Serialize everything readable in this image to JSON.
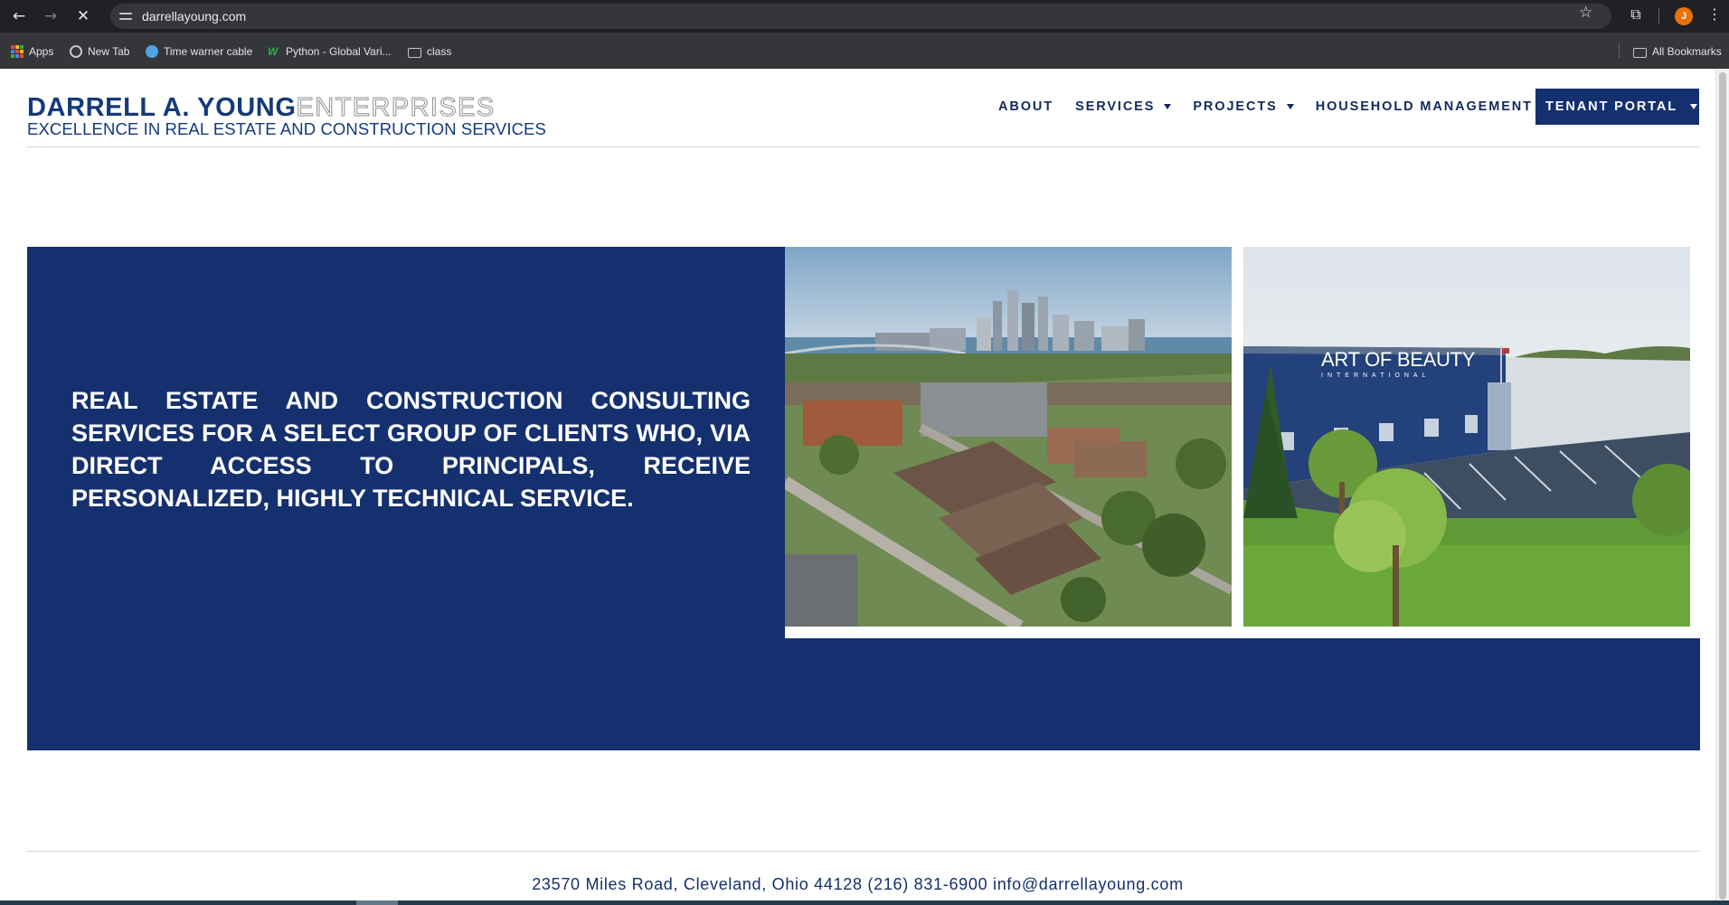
{
  "browser": {
    "url": "darrellayoung.com",
    "profile_initial": "J",
    "bookmarks": [
      {
        "label": "Apps",
        "icon": "apps-grid-icon"
      },
      {
        "label": "New Tab",
        "icon": "globe-icon"
      },
      {
        "label": "Time warner cable",
        "icon": "twc-icon"
      },
      {
        "label": "Python - Global Vari...",
        "icon": "w-icon"
      },
      {
        "label": "class",
        "icon": "folder-icon"
      }
    ],
    "all_bookmarks": "All Bookmarks"
  },
  "site": {
    "logo": {
      "name": "DARRELL A. YOUNG",
      "suffix": "ENTERPRISES",
      "tagline": "EXCELLENCE IN REAL ESTATE AND CONSTRUCTION SERVICES"
    },
    "nav": {
      "about": "ABOUT",
      "services": "SERVICES",
      "projects": "PROJECTS",
      "household": "HOUSEHOLD MANAGEMENT",
      "portal": "TENANT PORTAL"
    },
    "hero": {
      "text": "REAL ESTATE AND CONSTRUCTION CONSULTING SERVICES FOR A SELECT GROUP OF CLIENTS WHO, VIA DIRECT ACCESS TO PRINCIPALS, RECEIVE PERSONALIZED, HIGHLY TECHNICAL SERVICE.",
      "photo2_sign": "ART OF BEAUTY",
      "photo2_sign_sub": "INTERNATIONAL"
    },
    "footer": "23570 Miles Road, Cleveland, Ohio 44128 (216) 831-6900 info@darrellayoung.com"
  },
  "colors": {
    "brand_navy": "#14306e",
    "logo_gray": "#8c8f95",
    "chrome_dark": "#202124"
  }
}
